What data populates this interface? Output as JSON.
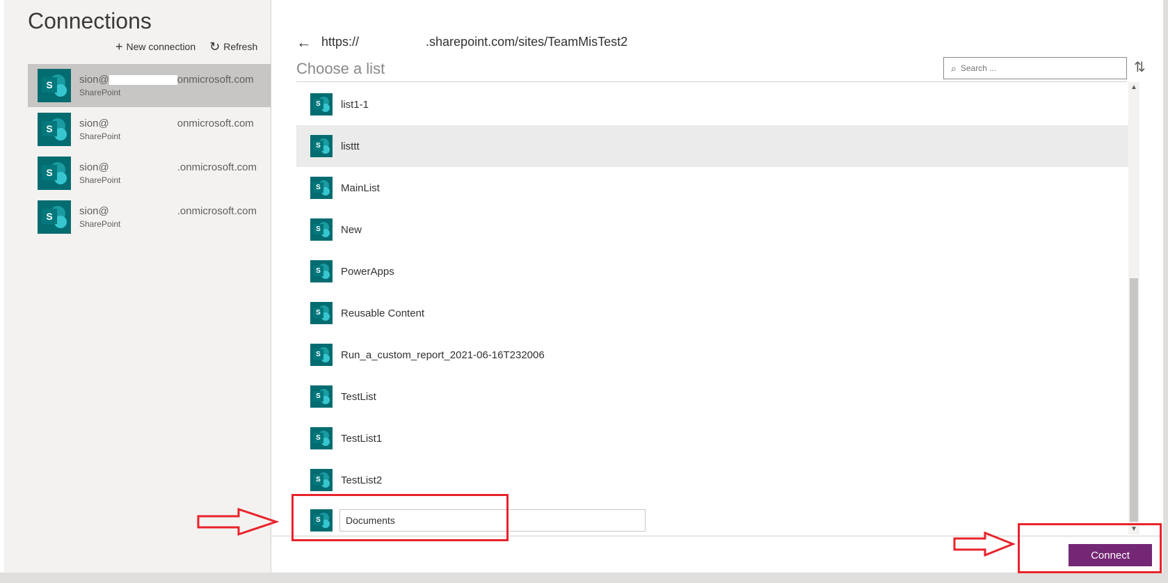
{
  "left": {
    "title": "Connections",
    "new_connection_label": "New connection",
    "refresh_label": "Refresh",
    "connections": [
      {
        "prefix": "sion@",
        "suffix": "onmicrosoft.com",
        "type": "SharePoint"
      },
      {
        "prefix": "sion@",
        "suffix": "onmicrosoft.com",
        "type": "SharePoint"
      },
      {
        "prefix": "sion@",
        "suffix": ".onmicrosoft.com",
        "type": "SharePoint"
      },
      {
        "prefix": "sion@",
        "suffix": ".onmicrosoft.com",
        "type": "SharePoint"
      }
    ]
  },
  "right": {
    "url_prefix": "https://",
    "url_suffix": ".sharepoint.com/sites/TeamMisTest2",
    "heading": "Choose a list",
    "search_placeholder": "Search ...",
    "lists": [
      "list1-1",
      "listtt",
      "MainList",
      "New",
      "PowerApps",
      "Reusable Content",
      "Run_a_custom_report_2021-06-16T232006",
      "TestList",
      "TestList1",
      "TestList2"
    ],
    "custom_list_value": "Documents",
    "connect_label": "Connect"
  },
  "colors": {
    "accent": "#742774",
    "sharepoint": "#036c70",
    "annotation": "#e8232b"
  }
}
